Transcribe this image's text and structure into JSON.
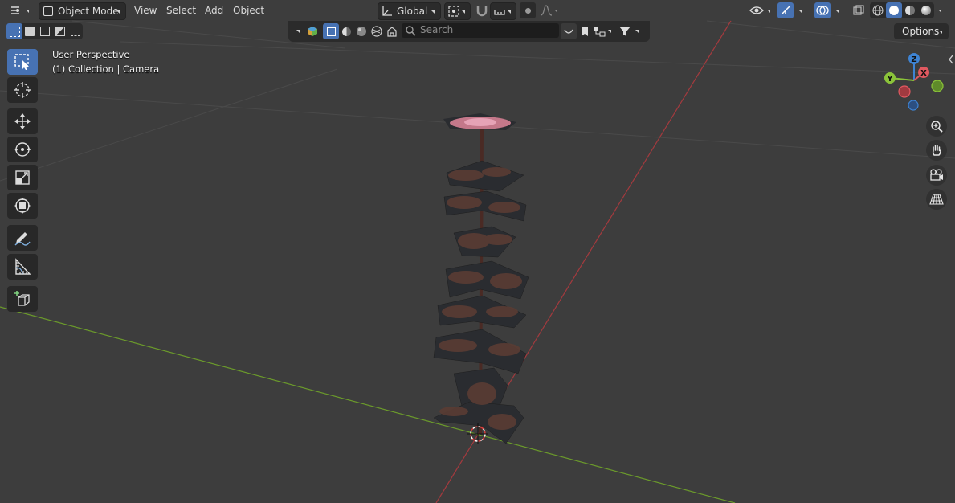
{
  "header": {
    "mode_label": "Object Mode",
    "menus": [
      "View",
      "Select",
      "Add",
      "Object"
    ],
    "transform_orientation": "Global"
  },
  "search": {
    "placeholder": "Search"
  },
  "options_label": "Options",
  "viewport": {
    "view_name": "User Perspective",
    "collection_info": "(1) Collection | Camera"
  },
  "gizmo": {
    "z": "Z",
    "y": "Y",
    "x": "X"
  },
  "colors": {
    "accent": "#4772b3",
    "axis_x": "#e15960",
    "axis_y": "#8bc33a",
    "axis_z": "#3e84d4",
    "x_line": "#a33a3e",
    "y_line": "#6b9a2b"
  }
}
